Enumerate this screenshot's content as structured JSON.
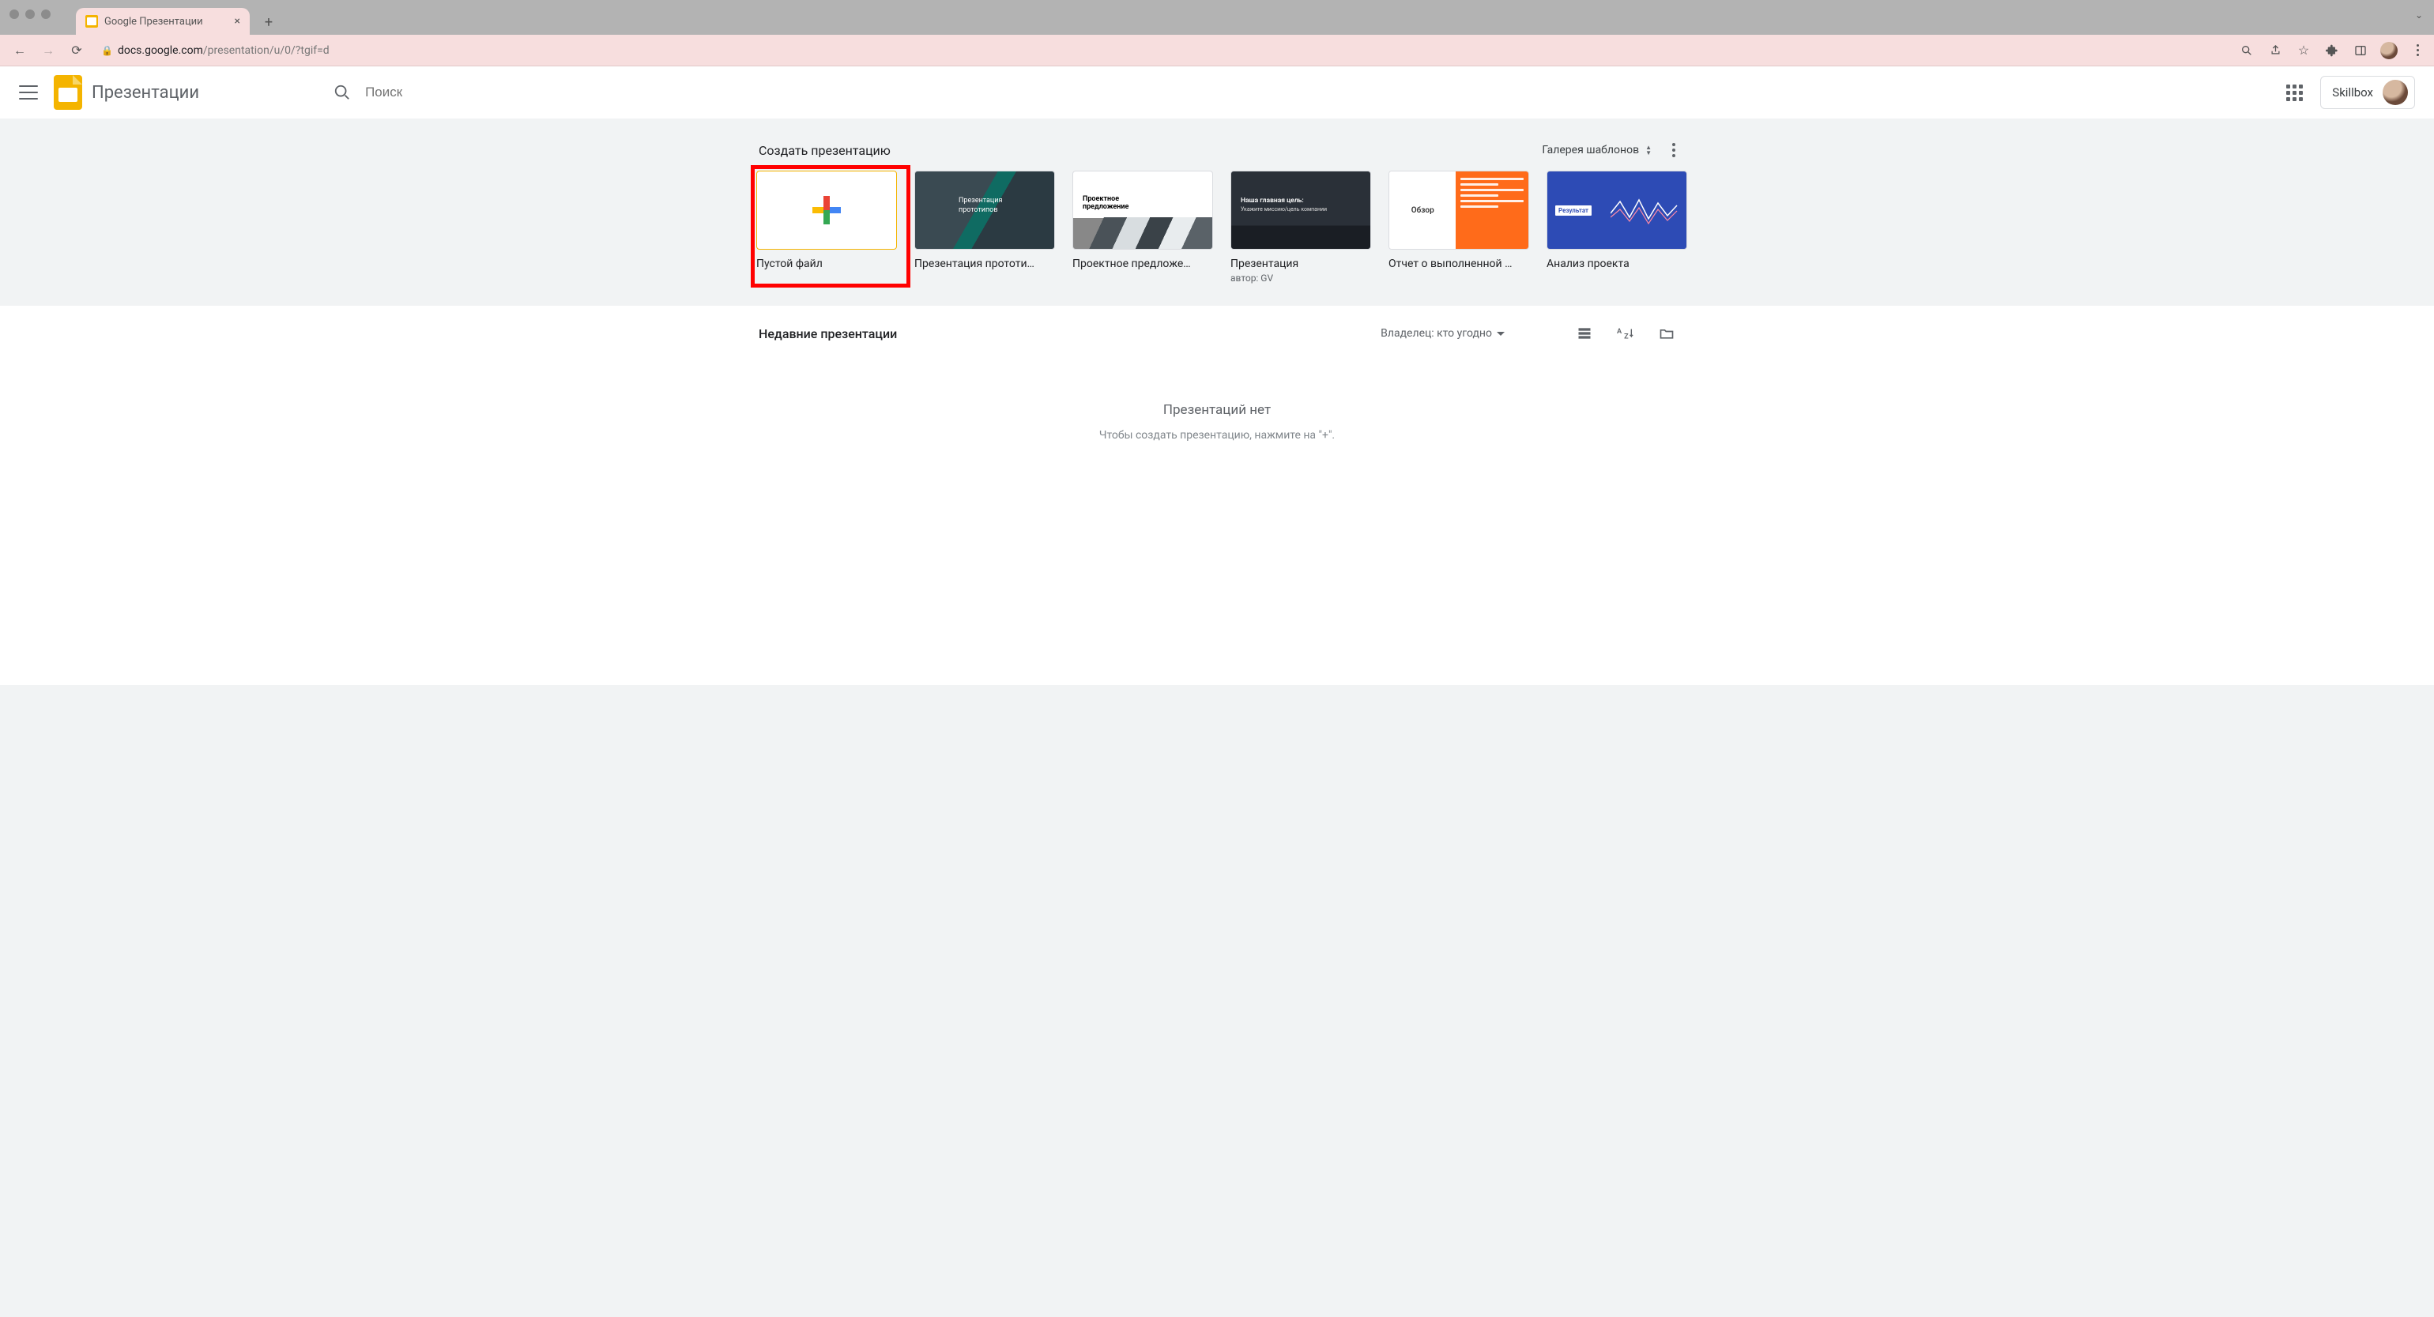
{
  "browser": {
    "tab_title": "Google Презентации",
    "url_host": "docs.google.com",
    "url_path": "/presentation/u/0/?tgif=d"
  },
  "header": {
    "app_title": "Презентации",
    "search_placeholder": "Поиск",
    "account_name": "Skillbox"
  },
  "templates": {
    "heading": "Создать презентацию",
    "gallery_button": "Галерея шаблонов",
    "cards": [
      {
        "label": "Пустой файл",
        "sub": ""
      },
      {
        "label": "Презентация прототи…",
        "sub": "",
        "thumb_title": "Презентация",
        "thumb_sub": "прототипов"
      },
      {
        "label": "Проектное предложе…",
        "sub": "",
        "thumb_title": "Проектное",
        "thumb_sub": "предложение"
      },
      {
        "label": "Презентация",
        "sub": "автор: GV",
        "thumb_title": "Наша главная цель:",
        "thumb_sub": "Укажите миссию/цель компании"
      },
      {
        "label": "Отчет о выполненной …",
        "sub": "",
        "thumb_title": "Обзор"
      },
      {
        "label": "Анализ проекта",
        "sub": "",
        "thumb_title": "Результат"
      }
    ]
  },
  "recent": {
    "heading": "Недавние презентации",
    "owner_filter": "Владелец: кто угодно",
    "empty_title": "Презентаций нет",
    "empty_sub": "Чтобы создать презентацию, нажмите на \"+\"."
  }
}
